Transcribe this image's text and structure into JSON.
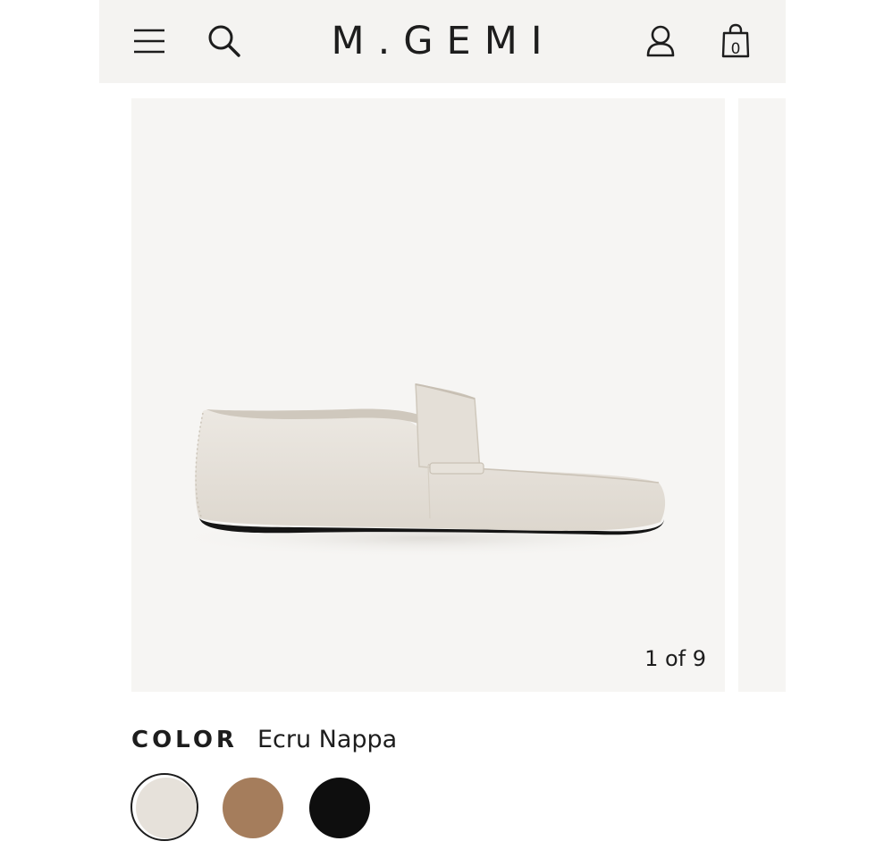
{
  "header": {
    "brand": "M.GEMI",
    "cart_count": "0",
    "icons": {
      "menu": "menu-icon",
      "search": "search-icon",
      "account": "account-icon",
      "cart": "shopping-bag-icon"
    }
  },
  "gallery": {
    "counter": "1 of 9",
    "background": "#f6f5f3"
  },
  "color_selector": {
    "label": "COLOR",
    "selected_name": "Ecru Nappa",
    "swatches": [
      {
        "name": "Ecru Nappa",
        "color": "#e6e1da",
        "selected": true
      },
      {
        "name": "Tan",
        "color": "#a57d5c",
        "selected": false
      },
      {
        "name": "Black",
        "color": "#0e0e0e",
        "selected": false
      }
    ]
  }
}
